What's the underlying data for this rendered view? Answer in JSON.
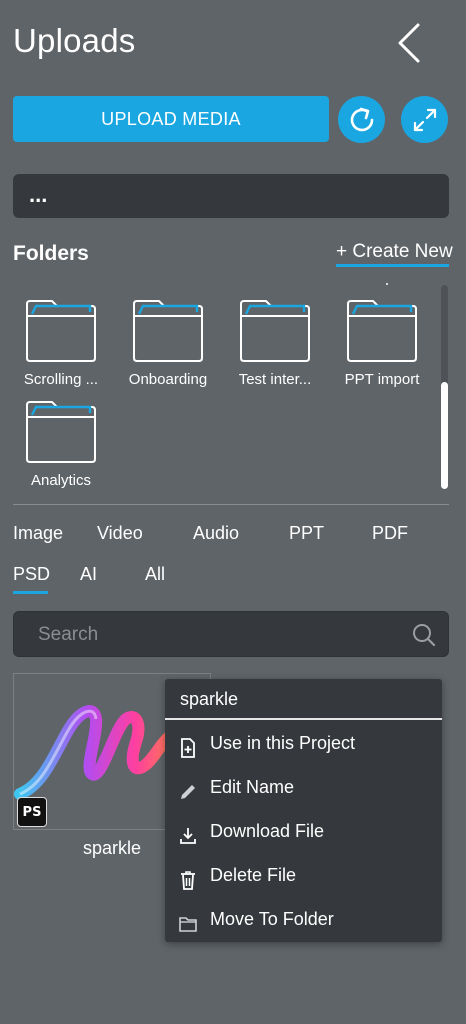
{
  "header": {
    "title": "Uploads"
  },
  "toolbar": {
    "upload_label": "UPLOAD MEDIA"
  },
  "path": {
    "value": "..."
  },
  "folders": {
    "heading": "Folders",
    "create_label": "+ Create New",
    "items": [
      {
        "label": "Scrolling ..."
      },
      {
        "label": "Onboarding"
      },
      {
        "label": "Test inter..."
      },
      {
        "label": "PPT import"
      },
      {
        "label": "Analytics"
      }
    ]
  },
  "filters": {
    "tabs": [
      "Image",
      "Video",
      "Audio",
      "PPT",
      "PDF",
      "PSD",
      "AI",
      "All"
    ],
    "active": "PSD"
  },
  "search": {
    "placeholder": "Search",
    "value": ""
  },
  "media": {
    "items": [
      {
        "name": "sparkle",
        "badge": "PS"
      }
    ]
  },
  "context_menu": {
    "title": "sparkle",
    "items": [
      {
        "label": "Use in this Project",
        "icon": "add-file-icon"
      },
      {
        "label": "Edit Name",
        "icon": "pencil-icon"
      },
      {
        "label": "Download File",
        "icon": "download-icon"
      },
      {
        "label": "Delete File",
        "icon": "trash-icon"
      },
      {
        "label": "Move To Folder",
        "icon": "folder-icon"
      }
    ]
  },
  "colors": {
    "accent": "#1aa7e1",
    "background": "#5f6468",
    "panel": "#35383c"
  }
}
